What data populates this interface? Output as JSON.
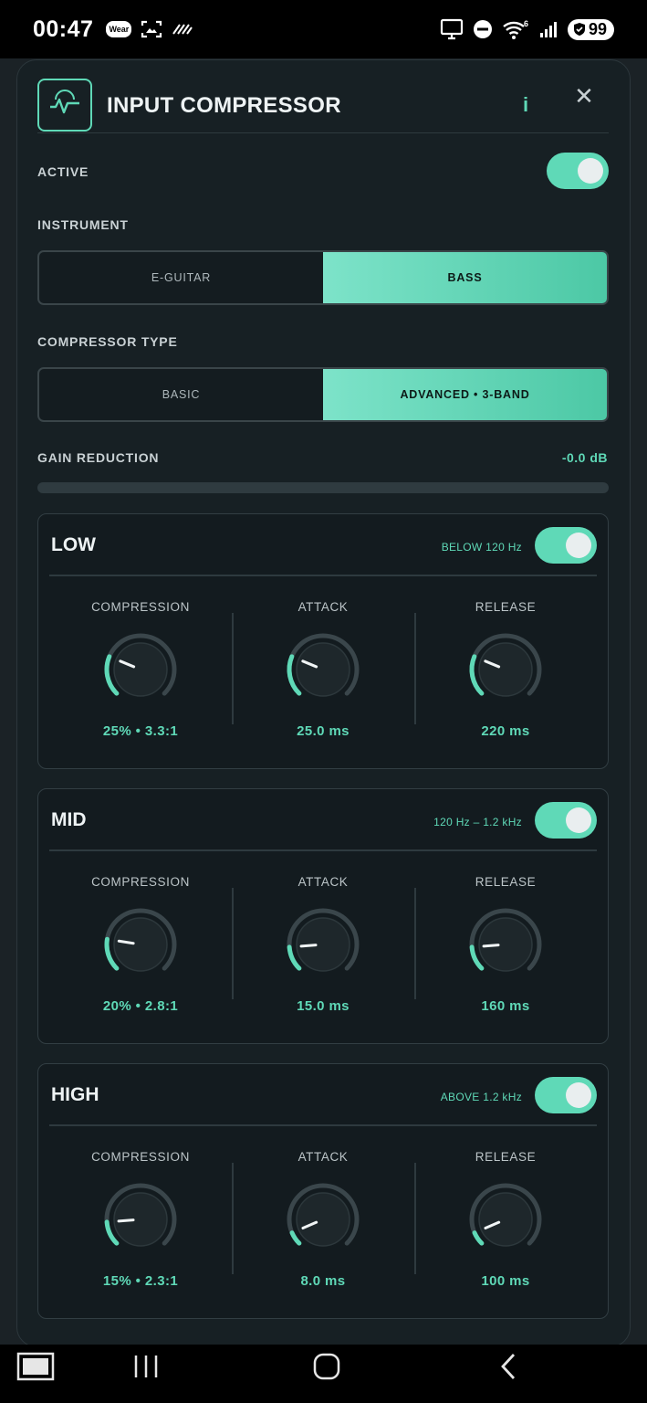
{
  "status_bar": {
    "time": "00:47",
    "wear_badge": "Wear",
    "battery": "99"
  },
  "header": {
    "title": "INPUT COMPRESSOR",
    "info_label": "i",
    "close_label": "✕"
  },
  "active": {
    "label": "ACTIVE",
    "on": true
  },
  "instrument": {
    "label": "INSTRUMENT",
    "options": [
      "E-GUITAR",
      "BASS"
    ],
    "selected": "BASS"
  },
  "compressor_type": {
    "label": "COMPRESSOR TYPE",
    "options": [
      "BASIC",
      "ADVANCED • 3-BAND"
    ],
    "selected": "ADVANCED • 3-BAND"
  },
  "gain_reduction": {
    "label": "GAIN REDUCTION",
    "value": "-0.0 dB",
    "fraction": 0
  },
  "bands": [
    {
      "name": "LOW",
      "range": "BELOW 120 Hz",
      "on": true,
      "compression": {
        "label": "COMPRESSION",
        "value": "25%  •  3.3:1",
        "fraction": 0.25
      },
      "attack": {
        "label": "ATTACK",
        "value": "25.0 ms",
        "fraction": 0.25
      },
      "release": {
        "label": "RELEASE",
        "value": "220 ms",
        "fraction": 0.25
      }
    },
    {
      "name": "MID",
      "range": "120 Hz – 1.2 kHz",
      "on": true,
      "compression": {
        "label": "COMPRESSION",
        "value": "20%  •  2.8:1",
        "fraction": 0.2
      },
      "attack": {
        "label": "ATTACK",
        "value": "15.0 ms",
        "fraction": 0.15
      },
      "release": {
        "label": "RELEASE",
        "value": "160 ms",
        "fraction": 0.15
      }
    },
    {
      "name": "HIGH",
      "range": "ABOVE 1.2 kHz",
      "on": true,
      "compression": {
        "label": "COMPRESSION",
        "value": "15%  •  2.3:1",
        "fraction": 0.15
      },
      "attack": {
        "label": "ATTACK",
        "value": "8.0 ms",
        "fraction": 0.08
      },
      "release": {
        "label": "RELEASE",
        "value": "100 ms",
        "fraction": 0.08
      }
    }
  ],
  "colors": {
    "accent": "#5fd9b7",
    "panel": "#172024",
    "band_bg": "#131b1f"
  }
}
